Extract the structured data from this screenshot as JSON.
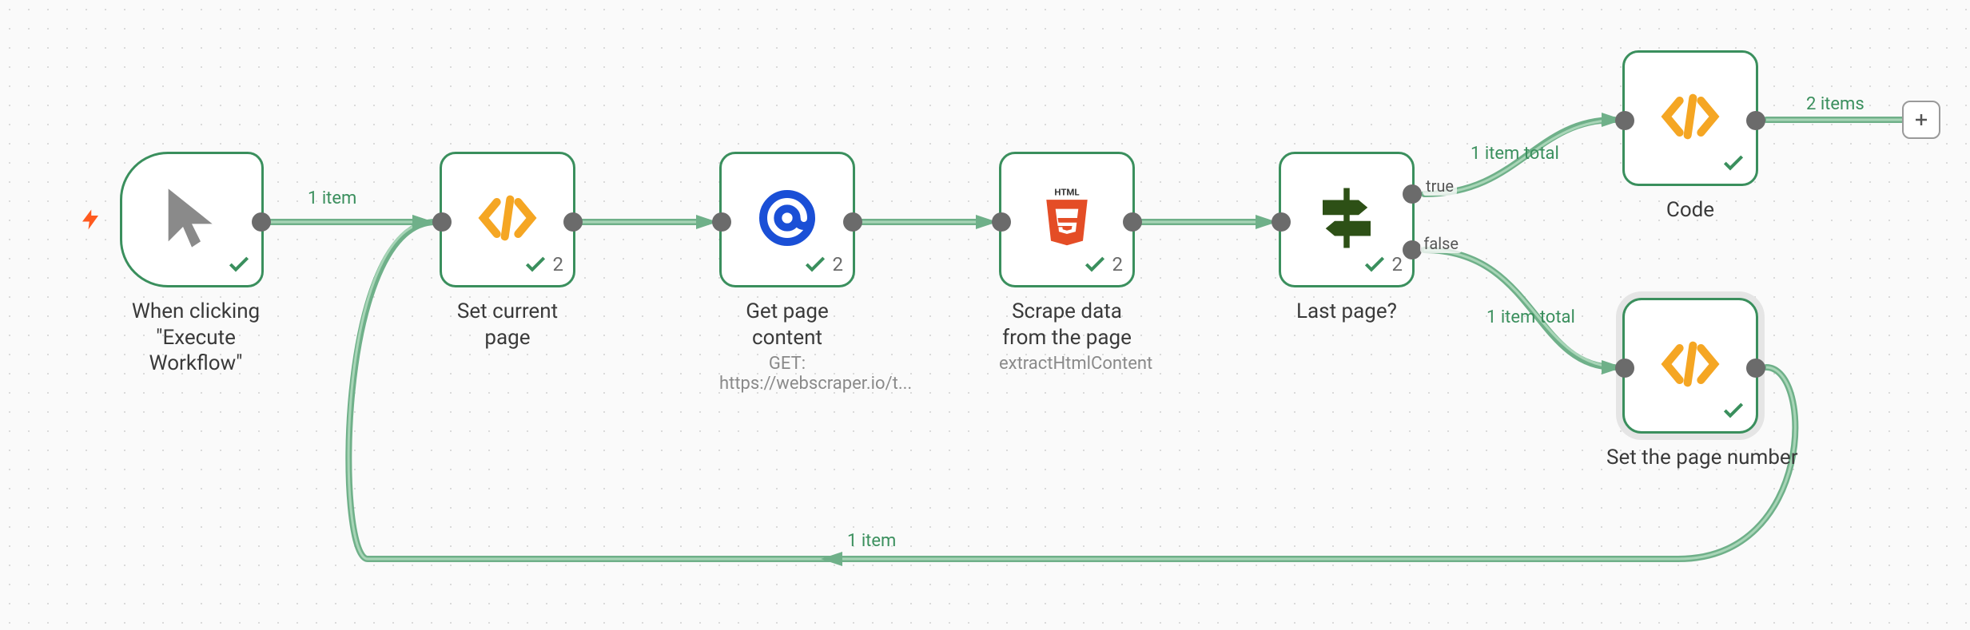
{
  "nodes": {
    "trigger": {
      "title": "When clicking \"Execute Workflow\""
    },
    "setpage": {
      "title": "Set current page",
      "count": "2"
    },
    "getpage": {
      "title": "Get page content",
      "subtitle": "GET: https://webscraper.io/t...",
      "count": "2"
    },
    "scrape": {
      "title": "Scrape data from the page",
      "subtitle": "extractHtmlContent",
      "count": "2"
    },
    "lastpage": {
      "title": "Last page?",
      "count": "2",
      "true_label": "true",
      "false_label": "false"
    },
    "code": {
      "title": "Code"
    },
    "setnum": {
      "title": "Set the page number"
    }
  },
  "edges": {
    "trigger_out": "1 item",
    "code_in": "2 items",
    "true_branch": "1 item total",
    "false_branch": "1 item total",
    "loop_back": "1 item"
  }
}
